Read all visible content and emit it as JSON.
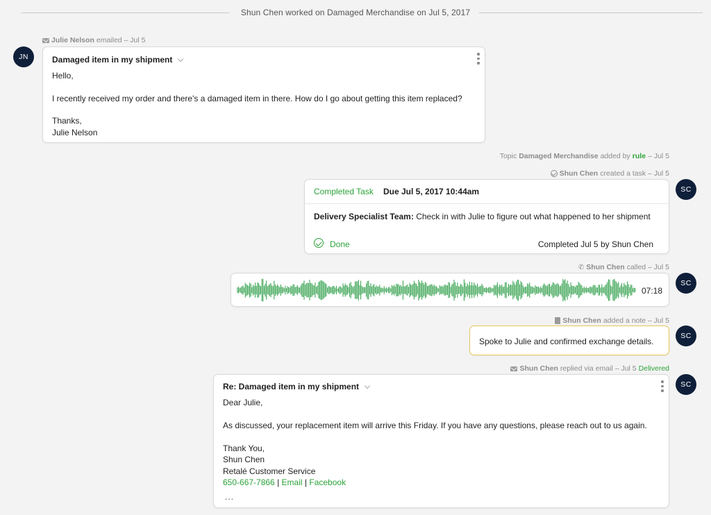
{
  "header": {
    "text": "Shun Chen worked on Damaged Merchandise on Jul 5, 2017"
  },
  "email1": {
    "meta": {
      "name": "Julie Nelson",
      "action": "emailed – Jul 5",
      "icon": "mail-icon"
    },
    "avatar": "JN",
    "subject": "Damaged item in my shipment",
    "lines": [
      "Hello,",
      "I recently received my order and there's a damaged item in there. How do I go about getting this item replaced?",
      "Thanks,",
      "Julie Nelson"
    ]
  },
  "topic_event": {
    "prefix": "Topic",
    "topic": "Damaged Merchandise",
    "mid": "added by",
    "by": "rule",
    "date": "– Jul 5"
  },
  "task": {
    "meta": {
      "name": "Shun Chen",
      "action": "created a task – Jul 5",
      "icon": "check-circle-icon"
    },
    "avatar": "SC",
    "status": "Completed Task",
    "due": "Due Jul 5, 2017 10:44am",
    "team": "Delivery Specialist Team:",
    "description": "Check in with Julie to figure out what happened to her shipment",
    "done_label": "Done",
    "completed": "Completed Jul 5  by Shun Chen"
  },
  "call": {
    "meta": {
      "name": "Shun Chen",
      "action": "called – Jul 5",
      "icon": "phone-icon"
    },
    "avatar": "SC",
    "duration": "07:18",
    "wave_color": "#2e9e48"
  },
  "note": {
    "meta": {
      "name": "Shun Chen",
      "action": "added a note – Jul 5",
      "icon": "note-icon"
    },
    "avatar": "SC",
    "text": "Spoke to Julie and confirmed exchange details."
  },
  "reply": {
    "meta": {
      "name": "Shun Chen",
      "action": "replied via email – Jul 5",
      "status": "Delivered",
      "icon": "mail-icon"
    },
    "avatar": "SC",
    "subject": "Re: Damaged item in my shipment",
    "lines": [
      "Dear Julie,",
      "As discussed, your replacement item will arrive this Friday. If you have any questions, please reach out to us again.",
      "Thank You,",
      "Shun Chen",
      "Retalé Customer Service"
    ],
    "phone": "650-667-7866",
    "email_link": "Email",
    "facebook_link": "Facebook",
    "separator": "|",
    "more": "…"
  },
  "colors": {
    "accent_green": "#2ca339",
    "avatar_bg": "#0f1f3a",
    "note_border": "#e8c85a"
  }
}
